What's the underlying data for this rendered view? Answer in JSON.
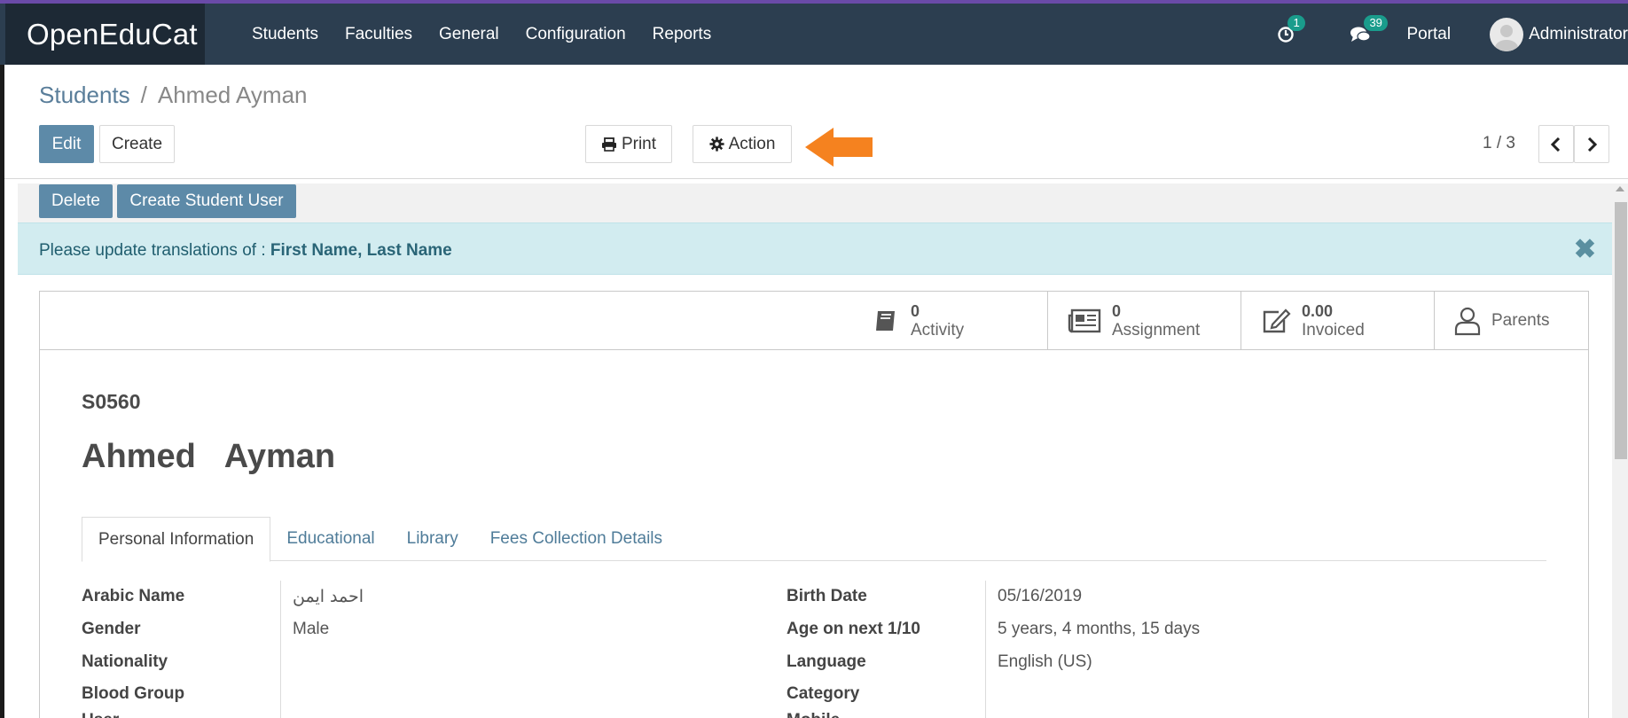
{
  "app": {
    "brand": "OpenEduCat"
  },
  "menu": [
    "Students",
    "Faculties",
    "General",
    "Configuration",
    "Reports"
  ],
  "systray": {
    "activity_count": "1",
    "messages_count": "39",
    "portal": "Portal",
    "user": "Administrator"
  },
  "breadcrumb": {
    "parent": "Students",
    "sep": "/",
    "current": "Ahmed Ayman"
  },
  "buttons": {
    "edit": "Edit",
    "create": "Create",
    "print": "Print",
    "action": "Action",
    "delete": "Delete",
    "create_student_user": "Create Student User"
  },
  "pager": {
    "value": "1 / 3"
  },
  "alert": {
    "text": "Please update translations of : ",
    "fields": "First Name, Last Name",
    "close": "✖"
  },
  "smart_buttons": {
    "activity": {
      "value": "0",
      "label": "Activity"
    },
    "assignment": {
      "value": "0",
      "label": "Assignment"
    },
    "invoiced": {
      "value": "0.00",
      "label": "Invoiced"
    },
    "parents": {
      "label": "Parents"
    }
  },
  "record": {
    "ref": "S0560",
    "first_name": "Ahmed",
    "last_name": "Ayman"
  },
  "tabs": [
    "Personal Information",
    "Educational",
    "Library",
    "Fees Collection Details"
  ],
  "fields_left": [
    {
      "label": "Arabic Name",
      "value": "احمد ايمن"
    },
    {
      "label": "Gender",
      "value": "Male"
    },
    {
      "label": "Nationality",
      "value": ""
    },
    {
      "label": "Blood Group",
      "value": ""
    },
    {
      "label": "User",
      "value": ""
    }
  ],
  "fields_right": [
    {
      "label": "Birth Date",
      "value": "05/16/2019"
    },
    {
      "label": "Age on next 1/10",
      "value": "5 years, 4 months, 15 days"
    },
    {
      "label": "Language",
      "value": "English (US)"
    },
    {
      "label": "Category",
      "value": ""
    },
    {
      "label": "Mobile",
      "value": ""
    }
  ],
  "colors": {
    "navbar": "#2c3e50",
    "brand_bg": "#1d2935",
    "primary": "#5d8aa8",
    "badge": "#1a9c8c",
    "alert_bg": "#d2ecf0",
    "arrow": "#f5821f"
  },
  "icons": {
    "activity": "book-icon",
    "assignment": "newspaper-icon",
    "invoiced": "edit-icon",
    "parents": "user-icon",
    "print": "print-icon",
    "action": "gear-icon"
  }
}
